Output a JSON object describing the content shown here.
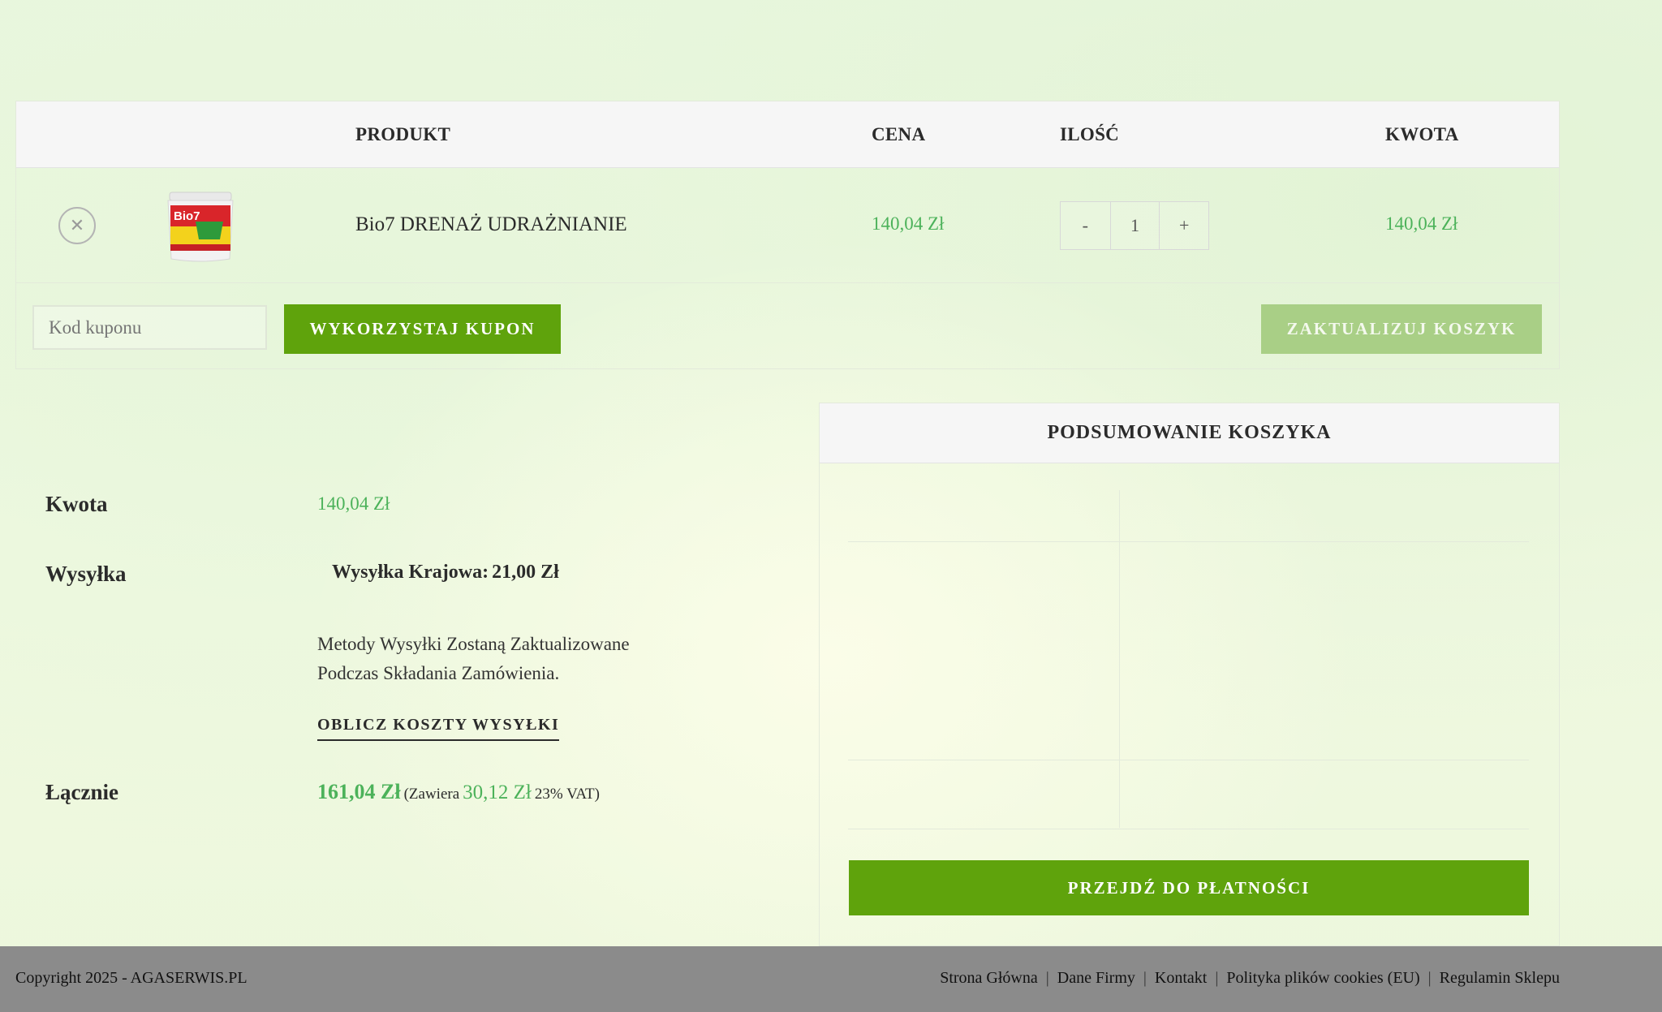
{
  "cart": {
    "headers": {
      "product": "PRODUKT",
      "price": "CENA",
      "quantity": "ILOŚĆ",
      "amount": "KWOTA"
    },
    "items": [
      {
        "name": "Bio7 DRENAŻ UDRAŻNIANIE",
        "price": "140,04 Zł",
        "quantity": "1",
        "amount": "140,04 Zł",
        "thumb_text": "Bio7"
      }
    ],
    "qty_minus": "-",
    "qty_plus": "+",
    "remove_symbol": "✕",
    "coupon_placeholder": "Kod kuponu",
    "apply_coupon": "WYKORZYSTAJ KUPON",
    "update_cart": "ZAKTUALIZUJ KOSZYK"
  },
  "totals": {
    "title": "PODSUMOWANIE KOSZYKA",
    "subtotal_label": "Kwota",
    "subtotal_value": "140,04 Zł",
    "shipping_label": "Wysyłka",
    "shipping_option_label": "Wysyłka Krajowa:",
    "shipping_option_price": "21,00 Zł",
    "shipping_note_line1": "Metody Wysyłki Zostaną Zaktualizowane",
    "shipping_note_line2": "Podczas Składania Zamówienia.",
    "calc_shipping": "OBLICZ KOSZTY WYSYŁKI",
    "total_label": "Łącznie",
    "total_value": "161,04 Zł",
    "tax_prefix": "(Zawiera",
    "tax_value": "30,12 Zł",
    "tax_suffix": "23% VAT)",
    "checkout": "PRZEJDŹ DO PŁATNOŚCI"
  },
  "footer": {
    "copyright": "Copyright 2025 - AGASERWIS.PL",
    "separator": "|",
    "links": [
      "Strona Główna",
      "Dane Firmy",
      "Kontakt",
      "Polityka plików cookies (EU)",
      "Regulamin Sklepu"
    ]
  },
  "colors": {
    "accent": "#5fa30c",
    "price": "#4cb25a",
    "update_button": "#a9cf86",
    "footer_bg": "#8b8b8b"
  }
}
